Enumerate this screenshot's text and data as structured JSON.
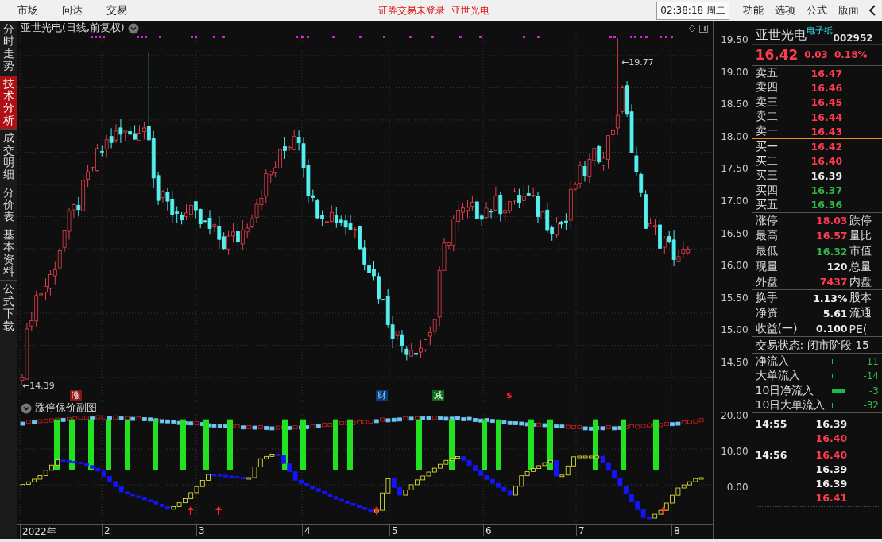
{
  "menu": [
    {
      "label": "市场"
    },
    {
      "label": "问达"
    },
    {
      "label": "交易"
    }
  ],
  "notice": {
    "text": "证券交易未登录",
    "stock": "亚世光电"
  },
  "clock": "02:38:18 周二",
  "toolbar": [
    {
      "label": "功能"
    },
    {
      "label": "选项"
    },
    {
      "label": "公式"
    },
    {
      "label": "版面"
    }
  ],
  "side_tabs": [
    {
      "label": "分时走势",
      "selected": false
    },
    {
      "label": "技术分析",
      "selected": true
    },
    {
      "label": "成交明细",
      "selected": false
    },
    {
      "label": "分价表",
      "selected": false
    },
    {
      "label": "基本资料",
      "selected": false
    },
    {
      "label": "公式下载",
      "selected": false
    }
  ],
  "chart": {
    "title": "亚世光电(日线,前复权)",
    "high_label": "←19.77",
    "low_label": "←14.39",
    "price_ticks": [
      "19.50",
      "19.00",
      "18.50",
      "18.00",
      "17.50",
      "17.00",
      "16.50",
      "16.00",
      "15.50",
      "15.00",
      "14.50"
    ],
    "events": [
      {
        "label": "涨",
        "kind": "limit"
      },
      {
        "label": "财",
        "kind": "finance"
      },
      {
        "label": "减",
        "kind": "reduce"
      },
      {
        "label": "$",
        "kind": "dividend"
      }
    ]
  },
  "indicator": {
    "title": "涨停保价副图",
    "ticks": [
      "20.00",
      "10.00",
      "0.00"
    ]
  },
  "months": [
    "2022年",
    "2",
    "3",
    "4",
    "5",
    "6",
    "7",
    "8"
  ],
  "quote": {
    "name": "亚世光电",
    "sector": "电子纸",
    "code": "002952",
    "price": "16.42",
    "change": "0.03",
    "percent": "0.18%",
    "asks": [
      {
        "label": "卖五",
        "price": "16.47",
        "color": "#ff3b4f"
      },
      {
        "label": "卖四",
        "price": "16.46",
        "color": "#ff3b4f"
      },
      {
        "label": "卖三",
        "price": "16.45",
        "color": "#ff3b4f"
      },
      {
        "label": "卖二",
        "price": "16.44",
        "color": "#ff3b4f"
      },
      {
        "label": "卖一",
        "price": "16.43",
        "color": "#ff3b4f"
      }
    ],
    "bids": [
      {
        "label": "买一",
        "price": "16.42",
        "color": "#ff3b4f"
      },
      {
        "label": "买二",
        "price": "16.40",
        "color": "#ff3b4f"
      },
      {
        "label": "买三",
        "price": "16.39",
        "color": "#eeeeee"
      },
      {
        "label": "买四",
        "price": "16.37",
        "color": "#2fb84a"
      },
      {
        "label": "买五",
        "price": "16.36",
        "color": "#2fb84a"
      }
    ],
    "stats": [
      {
        "label": "涨停",
        "value": "18.03",
        "color": "#ff3b4f",
        "label2": "跌停"
      },
      {
        "label": "最高",
        "value": "16.57",
        "color": "#ff3b4f",
        "label2": "量比"
      },
      {
        "label": "最低",
        "value": "16.32",
        "color": "#2fb84a",
        "label2": "市值"
      },
      {
        "label": "现量",
        "value": "120",
        "color": "#eeeeee",
        "label2": "总量"
      },
      {
        "label": "外盘",
        "value": "7437",
        "color": "#ff3b4f",
        "label2": "内盘"
      }
    ],
    "finance": [
      {
        "label": "换手",
        "value": "1.13%",
        "label2": "股本"
      },
      {
        "label": "净资",
        "value": "5.61",
        "label2": "流通"
      },
      {
        "label": "收益(一)",
        "value": "0.100",
        "label2": "PE("
      }
    ],
    "status": "交易状态: 闭市阶段 15",
    "flows": [
      {
        "label": "净流入",
        "value": "-11"
      },
      {
        "label": "大单流入",
        "value": "-14"
      },
      {
        "label": "10日净流入",
        "value": "-3"
      },
      {
        "label": "10日大单流入",
        "value": "-32"
      }
    ],
    "ticks": [
      {
        "time": "14:55",
        "prices": [
          {
            "price": "16.39",
            "color": "#eeeeee"
          },
          {
            "price": "16.40",
            "color": "#ff3b4f"
          }
        ]
      },
      {
        "time": "14:56",
        "prices": [
          {
            "price": "16.40",
            "color": "#ff3b4f"
          },
          {
            "price": "16.39",
            "color": "#eeeeee"
          },
          {
            "price": "16.39",
            "color": "#eeeeee"
          },
          {
            "price": "16.41",
            "color": "#ff3b4f"
          }
        ]
      }
    ]
  }
}
